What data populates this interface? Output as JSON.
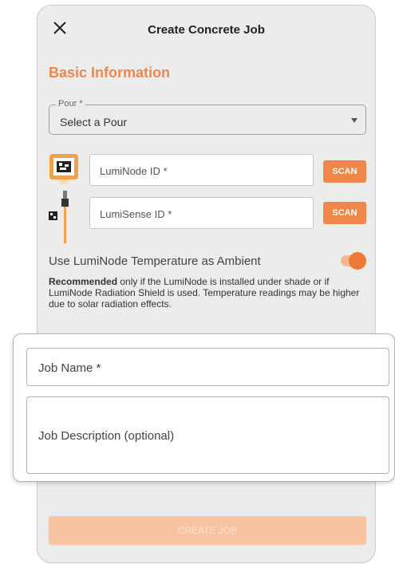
{
  "header": {
    "title": "Create Concrete Job",
    "close_icon": "close-icon"
  },
  "basic_info": {
    "title": "Basic Information"
  },
  "pour": {
    "label": "Pour *",
    "value": "Select a Pour"
  },
  "lumi_node": {
    "placeholder": "LumiNode ID *",
    "scan_label": "SCAN",
    "icon": "luminode-device-icon"
  },
  "lumi_sense": {
    "placeholder": "LumiSense ID *",
    "scan_label": "SCAN",
    "icon": "lumisense-sensor-icon"
  },
  "ambient": {
    "label": "Use LumiNode Temperature as Ambient",
    "enabled": true,
    "note_bold": "Recommended",
    "note_rest": " only if the LumiNode is installed under shade or if LumiNode Radiation Shield is used. Temperature readings may be higher due to solar radiation effects."
  },
  "job": {
    "name_placeholder": "Job Name *",
    "description_placeholder": "Job Description (optional)"
  },
  "actions": {
    "create_label": "CREATE JOB"
  },
  "colors": {
    "accent": "#f0874a",
    "accent_disabled": "#f8c3a1",
    "background": "#ececec"
  }
}
